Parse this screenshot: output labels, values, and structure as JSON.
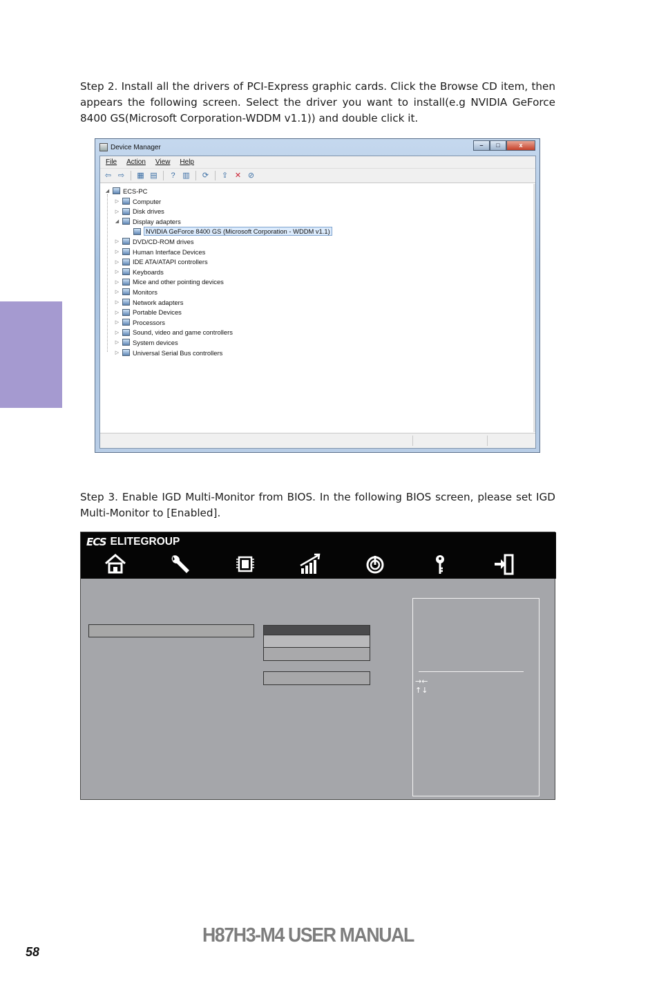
{
  "step2_text": "Step 2. Install all the drivers of PCI-Express graphic cards. Click the Browse CD item, then appears the following screen. Select the driver you want to install(e.g NVIDIA GeForce 8400 GS(Microsoft Corporation-WDDM v1.1)) and double click it.",
  "step3_text": "Step 3. Enable IGD Multi-Monitor from BIOS. In the following BIOS screen, please set IGD Multi-Monitor to [Enabled].",
  "device_manager": {
    "title": "Device Manager",
    "controls": {
      "minimize": "–",
      "maximize": "□",
      "close": "x"
    },
    "menu": [
      "File",
      "Action",
      "View",
      "Help"
    ],
    "root": "ECS-PC",
    "nodes": [
      {
        "label": "Computer",
        "expander": "▷",
        "icon": "computer-icon"
      },
      {
        "label": "Disk drives",
        "expander": "▷",
        "icon": "disk-drive-icon"
      },
      {
        "label": "Display adapters",
        "expander": "◢",
        "icon": "display-adapter-icon"
      },
      {
        "label": "NVIDIA GeForce 8400 GS (Microsoft Corporation - WDDM v1.1)",
        "expander": "",
        "icon": "display-adapter-icon",
        "child": true,
        "selected": true
      },
      {
        "label": "DVD/CD-ROM drives",
        "expander": "▷",
        "icon": "dvd-drive-icon"
      },
      {
        "label": "Human Interface Devices",
        "expander": "▷",
        "icon": "hid-icon"
      },
      {
        "label": "IDE ATA/ATAPI controllers",
        "expander": "▷",
        "icon": "ide-controller-icon"
      },
      {
        "label": "Keyboards",
        "expander": "▷",
        "icon": "keyboard-icon"
      },
      {
        "label": "Mice and other pointing devices",
        "expander": "▷",
        "icon": "mouse-icon"
      },
      {
        "label": "Monitors",
        "expander": "▷",
        "icon": "monitor-icon"
      },
      {
        "label": "Network adapters",
        "expander": "▷",
        "icon": "network-adapter-icon"
      },
      {
        "label": "Portable Devices",
        "expander": "▷",
        "icon": "portable-device-icon"
      },
      {
        "label": "Processors",
        "expander": "▷",
        "icon": "processor-icon"
      },
      {
        "label": "Sound, video and game controllers",
        "expander": "▷",
        "icon": "sound-icon"
      },
      {
        "label": "System devices",
        "expander": "▷",
        "icon": "system-device-icon"
      },
      {
        "label": "Universal Serial Bus controllers",
        "expander": "▷",
        "icon": "usb-icon"
      }
    ]
  },
  "bios": {
    "logo_mark": "ECS",
    "brand": "ELITEGROUP",
    "nav_icons": [
      "home-icon",
      "wrench-icon",
      "chip-icon",
      "performance-chart-icon",
      "power-icon",
      "key-icon",
      "exit-icon"
    ],
    "help_arrows": "→←\n↑↓"
  },
  "footer": {
    "manual_title": "H87H3-M4 USER MANUAL",
    "page_number": "58"
  },
  "colors": {
    "side_tab": "#a59ad0",
    "bios_bg": "#a5a6aa",
    "bios_header": "#050505"
  }
}
